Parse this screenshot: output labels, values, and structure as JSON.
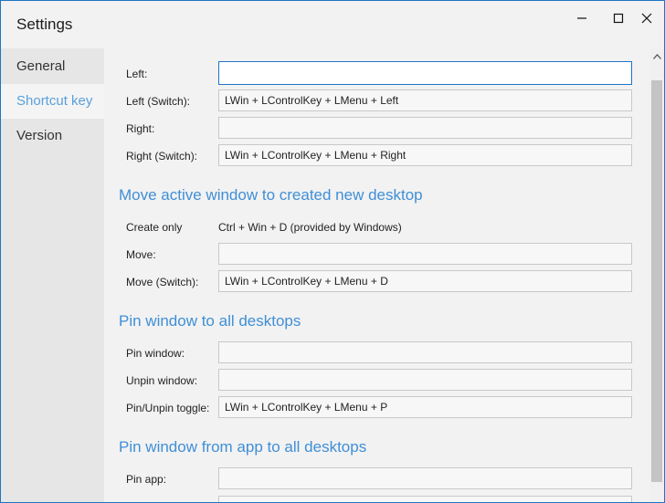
{
  "window": {
    "title": "Settings"
  },
  "sidebar": {
    "items": [
      {
        "label": "General",
        "selected": false
      },
      {
        "label": "Shortcut key",
        "selected": true
      },
      {
        "label": "Version",
        "selected": false
      }
    ]
  },
  "content": {
    "rows": [
      {
        "label": "Left:",
        "value": "",
        "focused": true
      },
      {
        "label": "Left (Switch):",
        "value": "LWin + LControlKey + LMenu + Left"
      },
      {
        "label": "Right:",
        "value": ""
      },
      {
        "label": "Right (Switch):",
        "value": "LWin + LControlKey + LMenu + Right"
      }
    ],
    "sections": [
      {
        "heading": "Move active window to created new desktop",
        "rows": [
          {
            "label": "Create only",
            "value": "Ctrl + Win + D (provided by Windows)",
            "static": true
          },
          {
            "label": "Move:",
            "value": ""
          },
          {
            "label": "Move (Switch):",
            "value": "LWin + LControlKey + LMenu + D"
          }
        ]
      },
      {
        "heading": "Pin window to all desktops",
        "rows": [
          {
            "label": "Pin window:",
            "value": ""
          },
          {
            "label": "Unpin window:",
            "value": ""
          },
          {
            "label": "Pin/Unpin toggle:",
            "value": "LWin + LControlKey + LMenu + P"
          }
        ]
      },
      {
        "heading": "Pin window from app to all desktops",
        "rows": [
          {
            "label": "Pin app:",
            "value": ""
          }
        ]
      }
    ]
  },
  "icons": {
    "minimize": "minimize-icon",
    "maximize": "maximize-icon",
    "close": "close-icon",
    "scroll_up": "chevron-up-icon"
  },
  "colors": {
    "accent": "#3f8fd6",
    "selected_nav_text": "#5aa0dc",
    "window_border": "#1f74c4"
  }
}
